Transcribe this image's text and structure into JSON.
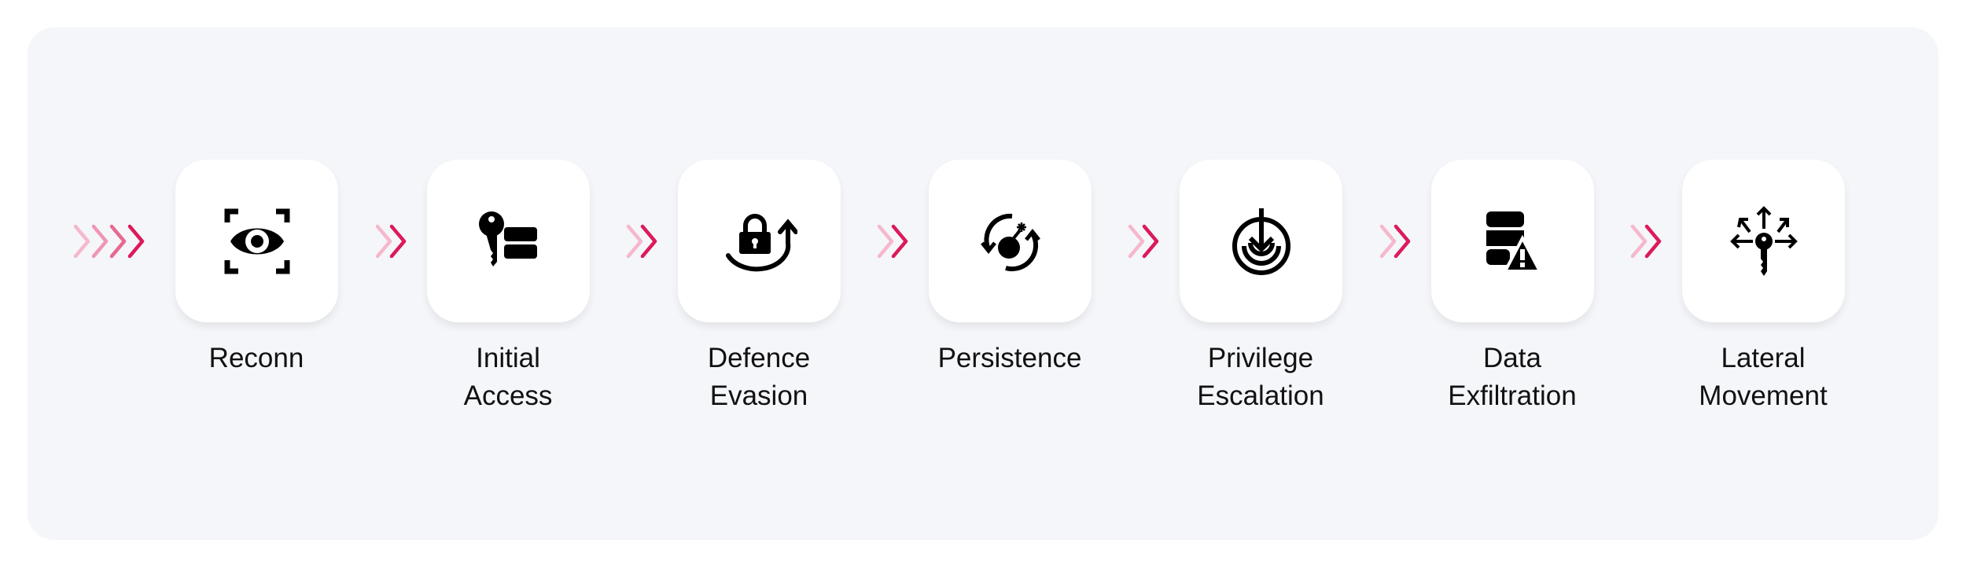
{
  "colors": {
    "chevron_light": "#f5b8cc",
    "chevron_mid1": "#ee97b5",
    "chevron_mid2": "#e8698f",
    "chevron_dark": "#dc1a5a",
    "panel": "#f5f6fa"
  },
  "stages": [
    {
      "label_line1": "Reconn",
      "label_line2": "",
      "icon": "eye-scan-icon"
    },
    {
      "label_line1": "Initial",
      "label_line2": "Access",
      "icon": "key-server-icon"
    },
    {
      "label_line1": "Defence",
      "label_line2": "Evasion",
      "icon": "lock-rotate-icon"
    },
    {
      "label_line1": "Persistence",
      "label_line2": "",
      "icon": "bomb-cycle-icon"
    },
    {
      "label_line1": "Privilege",
      "label_line2": "Escalation",
      "icon": "target-arrow-icon"
    },
    {
      "label_line1": "Data",
      "label_line2": "Exfiltration",
      "icon": "database-warning-icon"
    },
    {
      "label_line1": "Lateral",
      "label_line2": "Movement",
      "icon": "key-arrows-icon"
    }
  ]
}
